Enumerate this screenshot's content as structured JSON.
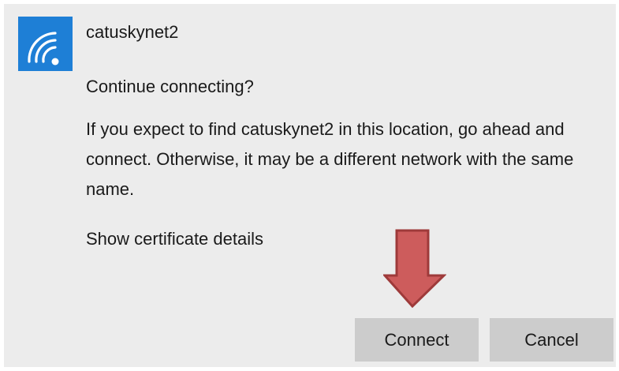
{
  "dialog": {
    "network_name": "catuskynet2",
    "prompt": "Continue connecting?",
    "message": "If you expect to find catuskynet2 in this location, go ahead and connect. Otherwise, it may be a different network with the same name.",
    "certificate_link": "Show certificate details"
  },
  "buttons": {
    "connect_label": "Connect",
    "cancel_label": "Cancel"
  },
  "icons": {
    "network": "wifi-icon",
    "annotation": "down-arrow-annotation"
  },
  "colors": {
    "tile": "#1e7fd6",
    "panel": "#ececec",
    "button": "#cccccc",
    "arrow_fill": "#cd5c5c",
    "arrow_stroke": "#9e3a3a"
  }
}
